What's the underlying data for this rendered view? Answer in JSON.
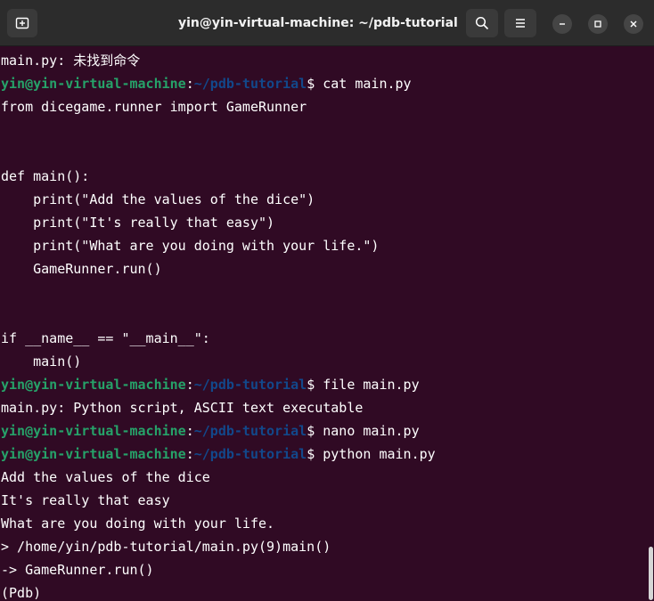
{
  "window": {
    "title": "yin@yin-virtual-machine: ~/pdb-tutorial"
  },
  "icons": {
    "new_tab": "new-tab-icon",
    "search": "search-icon",
    "menu": "hamburger-menu-icon",
    "minimize": "minimize-icon",
    "maximize": "maximize-icon",
    "close": "close-icon"
  },
  "colors": {
    "background": "#300a24",
    "titlebar": "#2c2c2c",
    "prompt_user": "#26a269",
    "prompt_path": "#12488b",
    "text": "#ffffff"
  },
  "prompt": {
    "user": "yin@yin-virtual-machine",
    "sep": ":",
    "path": "~/pdb-tutorial",
    "symbol": "$ "
  },
  "lines": [
    {
      "text": "main.py: 未找到命令"
    },
    {
      "cmd": "cat main.py"
    },
    {
      "text": "from dicegame.runner import GameRunner"
    },
    {
      "text": ""
    },
    {
      "text": ""
    },
    {
      "text": "def main():"
    },
    {
      "text": "    print(\"Add the values of the dice\")"
    },
    {
      "text": "    print(\"It's really that easy\")"
    },
    {
      "text": "    print(\"What are you doing with your life.\")"
    },
    {
      "text": "    GameRunner.run()"
    },
    {
      "text": ""
    },
    {
      "text": ""
    },
    {
      "text": "if __name__ == \"__main__\":"
    },
    {
      "text": "    main()"
    },
    {
      "cmd": "file main.py"
    },
    {
      "text": "main.py: Python script, ASCII text executable"
    },
    {
      "cmd": "nano main.py"
    },
    {
      "cmd": "python main.py"
    },
    {
      "text": "Add the values of the dice"
    },
    {
      "text": "It's really that easy"
    },
    {
      "text": "What are you doing with your life."
    },
    {
      "text": "> /home/yin/pdb-tutorial/main.py(9)main()"
    },
    {
      "text": "-> GameRunner.run()"
    },
    {
      "text": "(Pdb) "
    }
  ]
}
